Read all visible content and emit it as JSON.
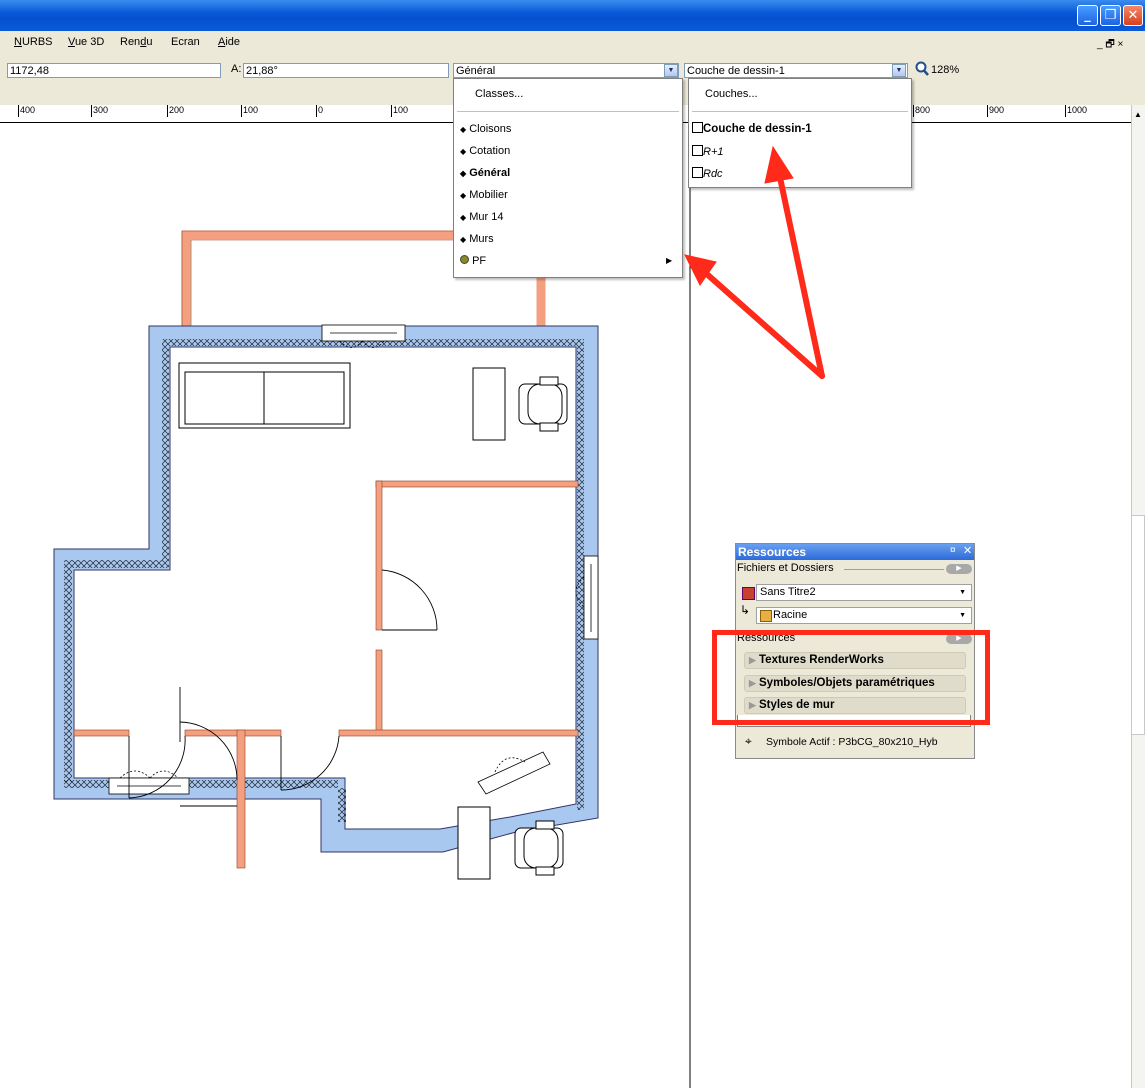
{
  "window": {
    "min_glyph": "_",
    "restore_glyph": "❐",
    "close_glyph": "✕"
  },
  "menubar": {
    "items": [
      {
        "label": "NURBS",
        "accel": "N"
      },
      {
        "label": "Vue 3D",
        "accel": "V"
      },
      {
        "label": "Rendu",
        "accel": "d"
      },
      {
        "label": "Ecran",
        "accel": ""
      },
      {
        "label": "Aide",
        "accel": "A"
      }
    ],
    "right_controls": "_ 🗗 ×"
  },
  "toolbar": {
    "coord_value": "1172,48",
    "angle_label": "A:",
    "angle_value": "21,88°",
    "class_value": "Général",
    "layer_value": "Couche de dessin-1",
    "zoom_value": "128%"
  },
  "ruler": {
    "ticks": [
      "400",
      "300",
      "200",
      "100",
      "0",
      "100",
      "800",
      "900",
      "1000"
    ]
  },
  "class_menu": {
    "header": "Classes...",
    "items": [
      {
        "label": "Cloisons",
        "bold": false
      },
      {
        "label": "Cotation",
        "bold": false
      },
      {
        "label": "Général",
        "bold": true
      },
      {
        "label": "Mobilier",
        "bold": false
      },
      {
        "label": "Mur 14",
        "bold": false
      },
      {
        "label": "Murs",
        "bold": false
      },
      {
        "label": "PF",
        "bold": false,
        "submenu": true
      }
    ]
  },
  "layer_menu": {
    "header": "Couches...",
    "items": [
      {
        "label": "Couche de dessin-1",
        "style": "bold"
      },
      {
        "label": "R+1",
        "style": "italic"
      },
      {
        "label": "Rdc",
        "style": "italic"
      }
    ]
  },
  "resources": {
    "title": "Ressources",
    "files_label": "Fichiers et Dossiers",
    "file_value": "Sans Titre2",
    "folder_value": "Racine",
    "section_label": "Ressources",
    "buttons": [
      "Textures RenderWorks",
      "Symboles/Objets paramétriques",
      "Styles de mur"
    ],
    "status": "Symbole Actif : P3bCG_80x210_Hyb"
  },
  "colors": {
    "annotation": "#ff2a1a",
    "wall": "#a8c8f0",
    "partition": "#f4a080"
  }
}
